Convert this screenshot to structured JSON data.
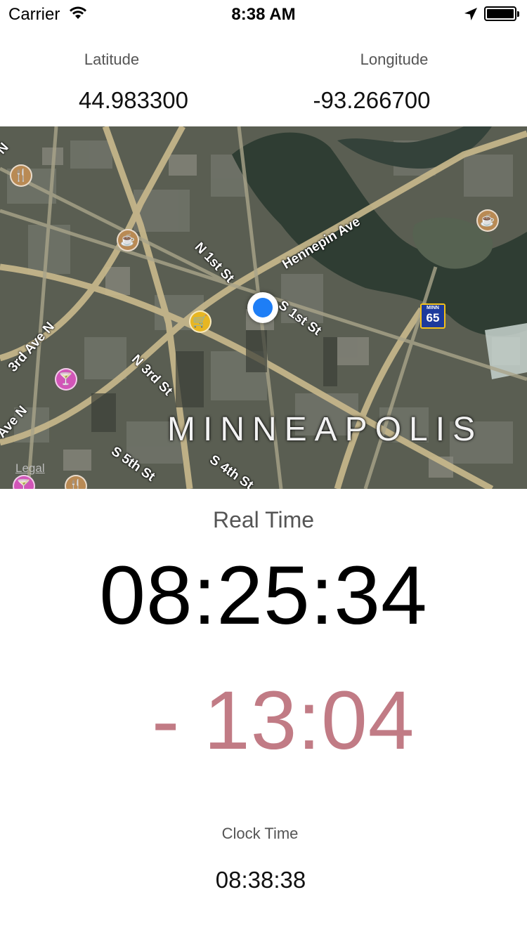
{
  "status_bar": {
    "carrier": "Carrier",
    "time": "8:38 AM"
  },
  "coordinates": {
    "latitude_label": "Latitude",
    "latitude_value": "44.983300",
    "longitude_label": "Longitude",
    "longitude_value": "-93.266700"
  },
  "map": {
    "city_label": "MINNEAPOLIS",
    "legal_link": "Legal",
    "highway_shield": {
      "state": "MINN",
      "number": "65"
    },
    "streets": [
      "N 1st St",
      "Hennepin Ave",
      "S 1st St",
      "3rd Ave N",
      "N 3rd St",
      "S 5th St",
      "S 4th St",
      "Ave N",
      "N"
    ]
  },
  "real_time": {
    "label": "Real Time",
    "value": "08:25:34"
  },
  "offset": {
    "value": "- 13:04",
    "color": "#c17b85"
  },
  "clock_time": {
    "label": "Clock Time",
    "value": "08:38:38"
  }
}
